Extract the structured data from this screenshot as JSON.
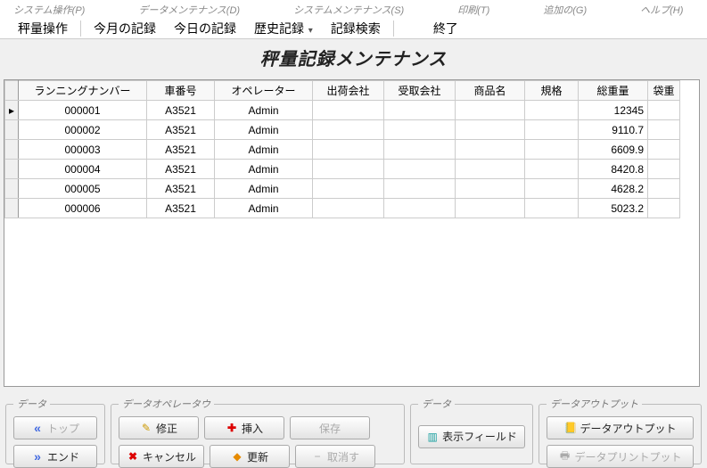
{
  "menubar": {
    "system_op": "システム操作(P)",
    "data_maint": "データメンテナンス(D)",
    "sys_maint": "システムメンテナンス(S)",
    "print": "印刷(T)",
    "add": "追加の(G)",
    "help": "ヘルプ(H)"
  },
  "toolbar": {
    "weigh": "秤量操作",
    "month": "今月の記録",
    "today": "今日の記録",
    "history": "歴史記録",
    "search": "記録検索",
    "exit": "終了"
  },
  "page_title": "秤量記録メンテナンス",
  "columns": {
    "running": "ランニングナンバー",
    "car": "車番号",
    "operator": "オペレーター",
    "shipper": "出荷会社",
    "receiver": "受取会社",
    "product": "商品名",
    "spec": "規格",
    "gross": "総重量",
    "bags": "袋重"
  },
  "rows": [
    {
      "running": "000001",
      "car": "A3521",
      "operator": "Admin",
      "shipper": "",
      "receiver": "",
      "product": "",
      "spec": "",
      "gross": "12345"
    },
    {
      "running": "000002",
      "car": "A3521",
      "operator": "Admin",
      "shipper": "",
      "receiver": "",
      "product": "",
      "spec": "",
      "gross": "9110.7"
    },
    {
      "running": "000003",
      "car": "A3521",
      "operator": "Admin",
      "shipper": "",
      "receiver": "",
      "product": "",
      "spec": "",
      "gross": "6609.9"
    },
    {
      "running": "000004",
      "car": "A3521",
      "operator": "Admin",
      "shipper": "",
      "receiver": "",
      "product": "",
      "spec": "",
      "gross": "8420.8"
    },
    {
      "running": "000005",
      "car": "A3521",
      "operator": "Admin",
      "shipper": "",
      "receiver": "",
      "product": "",
      "spec": "",
      "gross": "4628.2"
    },
    {
      "running": "000006",
      "car": "A3521",
      "operator": "Admin",
      "shipper": "",
      "receiver": "",
      "product": "",
      "spec": "",
      "gross": "5023.2"
    }
  ],
  "groups": {
    "data": "データ",
    "data_op": "データオペレータウ",
    "data2": "データ",
    "data_out": "データアウトプット"
  },
  "buttons": {
    "top": "トップ",
    "end": "エンド",
    "edit": "修正",
    "cancel": "キャンセル",
    "insert": "挿入",
    "update": "更新",
    "save": "保存",
    "undo": "取消す",
    "show_fields": "表示フィールド",
    "data_output": "データアウトプット",
    "data_print": "データプリントプット"
  }
}
